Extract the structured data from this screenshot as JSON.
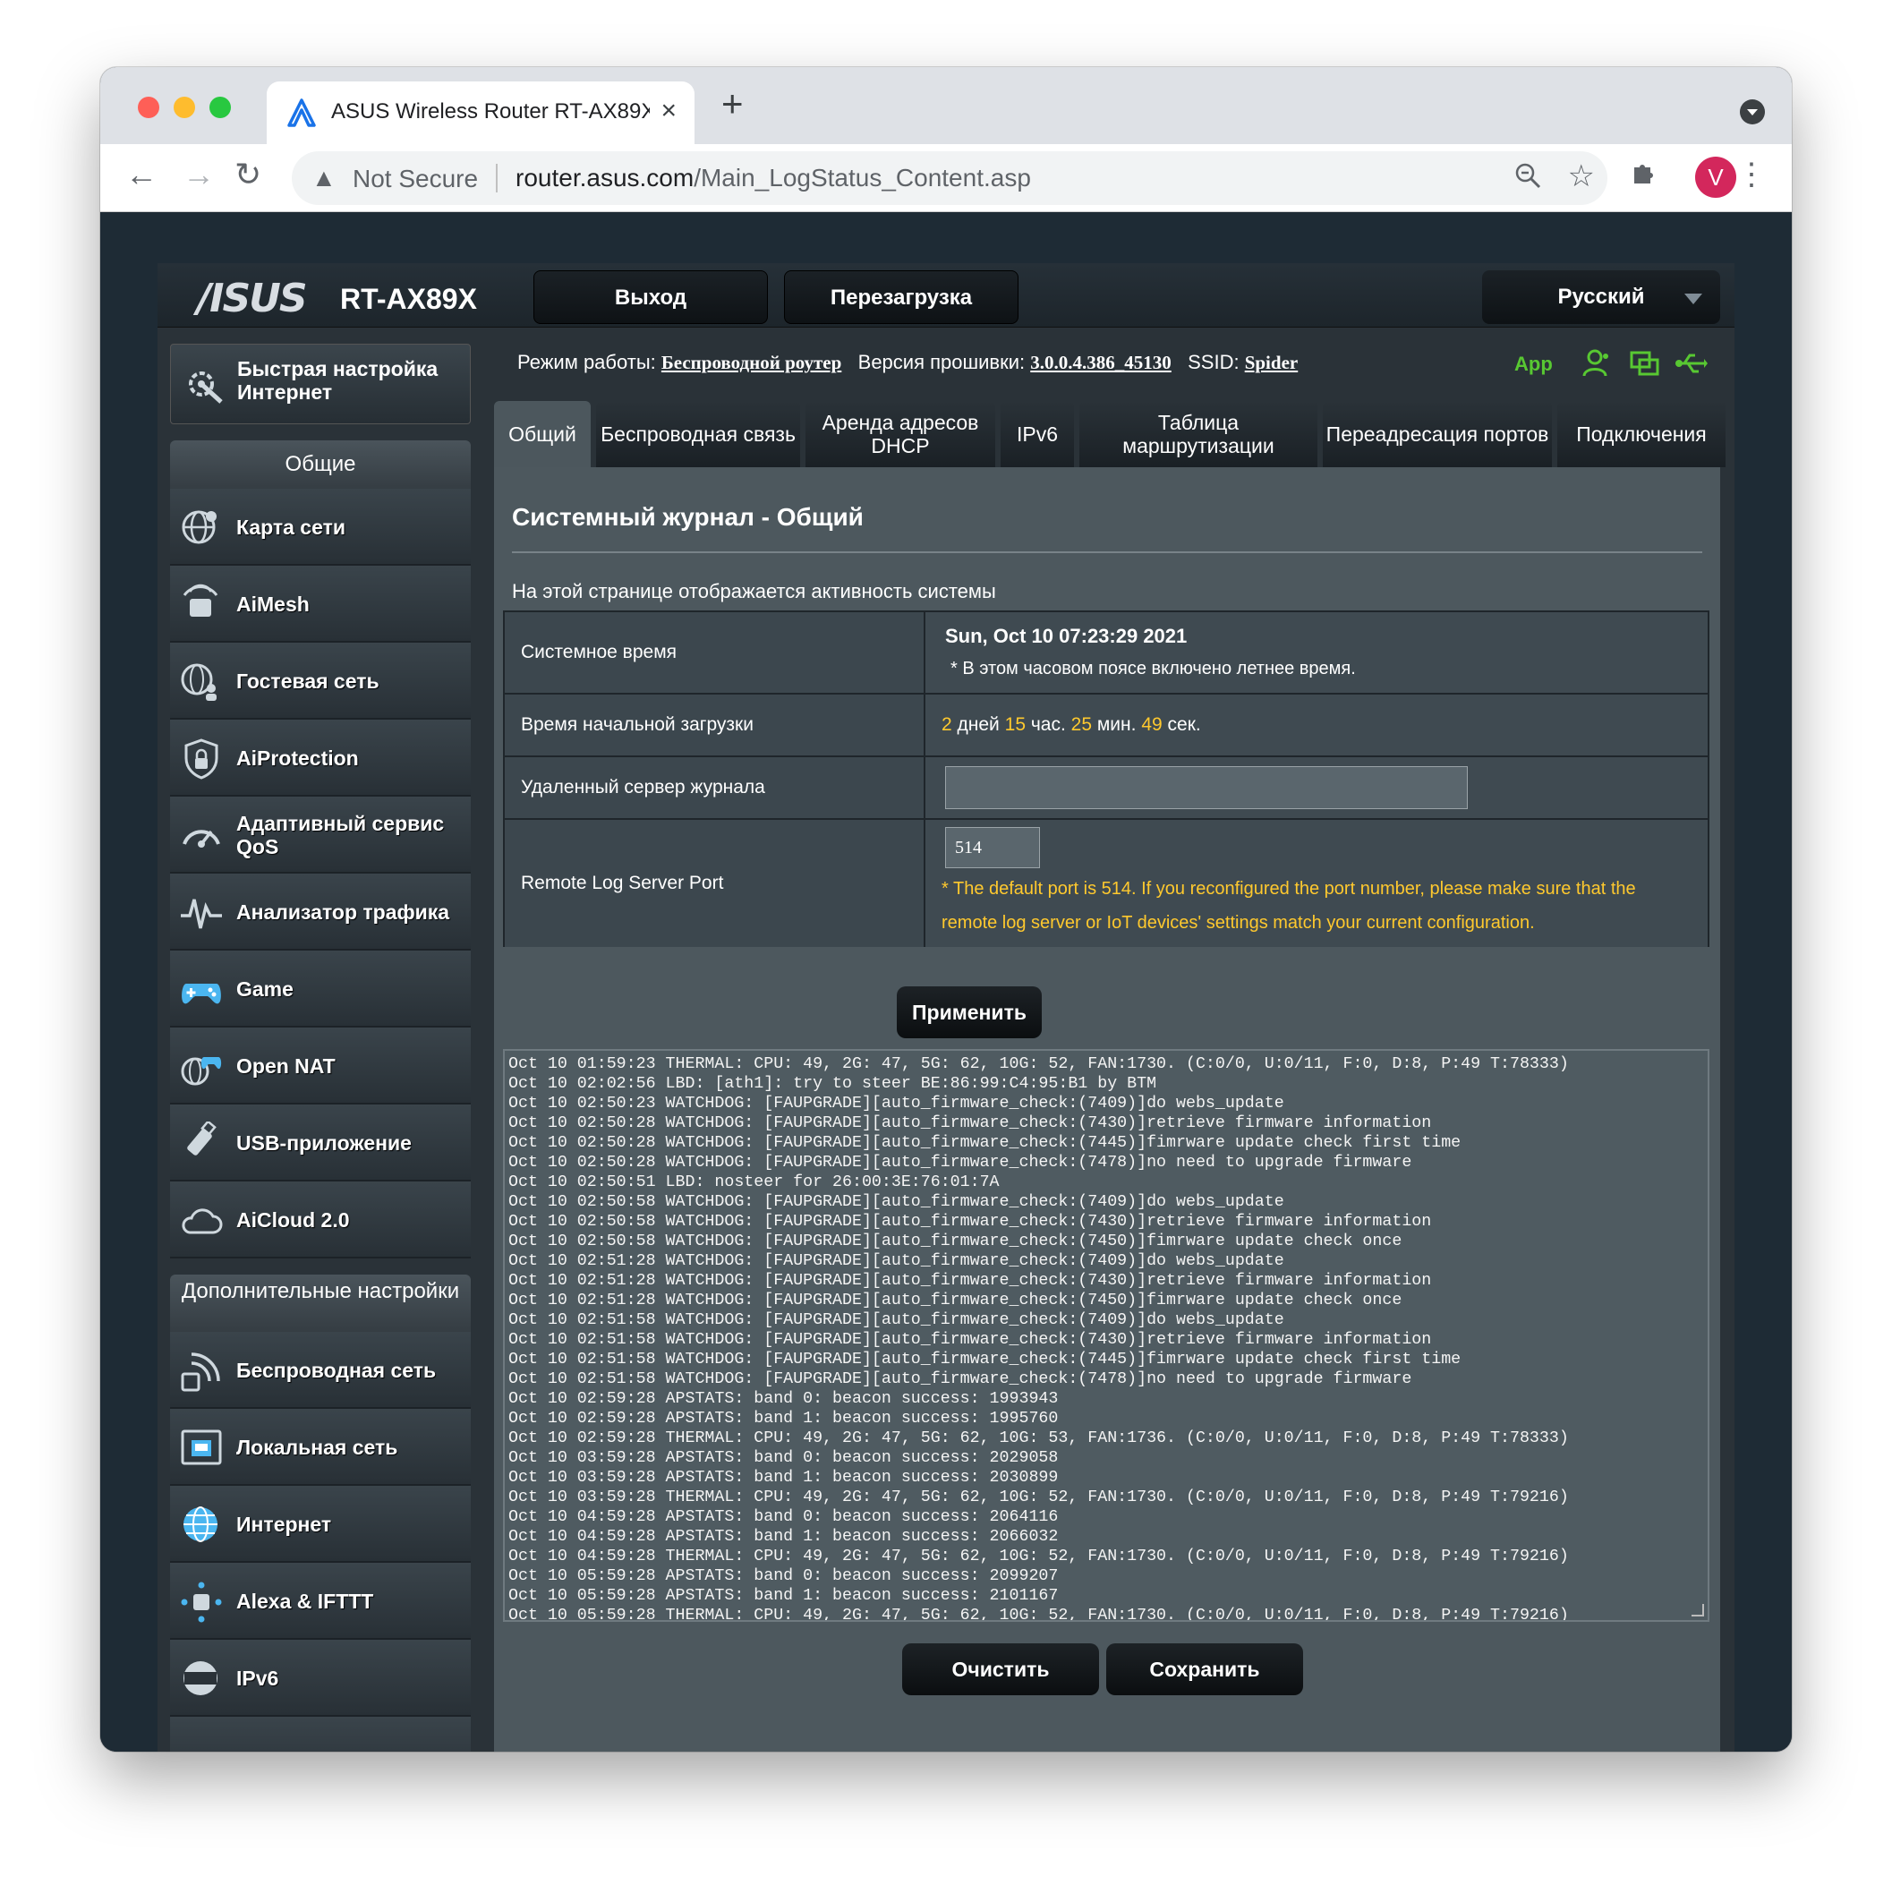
{
  "browser": {
    "tab_title": "ASUS Wireless Router RT-AX89X",
    "new_tab_glyph": "+",
    "security_label": "Not Secure",
    "url_host": "router.asus.com",
    "url_path": "/Main_LogStatus_Content.asp",
    "profile_initial": "V"
  },
  "router": {
    "brand": "/ISUS",
    "model": "RT-AX89X",
    "logout_label": "Выход",
    "reboot_label": "Перезагрузка",
    "language_label": "Русский",
    "status": {
      "mode_label": "Режим работы:",
      "mode_value": "Беспроводной роутер",
      "fw_label": "Версия прошивки:",
      "fw_value": "3.0.0.4.386_45130",
      "ssid_label": "SSID:",
      "ssid_value": "Spider",
      "app_label": "App"
    }
  },
  "sidebar": {
    "quick_setup": "Быстрая настройка Интернет",
    "general_header": "Общие",
    "general_items": [
      {
        "label": "Карта сети",
        "icon": "globe-map-icon"
      },
      {
        "label": "AiMesh",
        "icon": "aimesh-icon"
      },
      {
        "label": "Гостевая сеть",
        "icon": "guest-network-icon"
      },
      {
        "label": "AiProtection",
        "icon": "shield-lock-icon"
      },
      {
        "label": "Адаптивный сервис QoS",
        "icon": "gauge-icon"
      },
      {
        "label": "Анализатор трафика",
        "icon": "traffic-wave-icon"
      },
      {
        "label": "Game",
        "icon": "gamepad-icon"
      },
      {
        "label": "Open NAT",
        "icon": "open-nat-icon"
      },
      {
        "label": "USB-приложение",
        "icon": "usb-icon"
      },
      {
        "label": "AiCloud 2.0",
        "icon": "cloud-icon"
      }
    ],
    "advanced_header": "Дополнительные настройки",
    "advanced_items": [
      {
        "label": "Беспроводная сеть",
        "icon": "wireless-icon"
      },
      {
        "label": "Локальная сеть",
        "icon": "lan-icon"
      },
      {
        "label": "Интернет",
        "icon": "internet-globe-icon"
      },
      {
        "label": "Alexa & IFTTT",
        "icon": "alexa-icon"
      },
      {
        "label": "IPv6",
        "icon": "ipv6-icon"
      }
    ]
  },
  "tabs": [
    {
      "label": "Общий",
      "active": true
    },
    {
      "label": "Беспроводная связь"
    },
    {
      "label": "Аренда адресов DHCP"
    },
    {
      "label": "IPv6"
    },
    {
      "label": "Таблица маршрутизации"
    },
    {
      "label": "Переадресация портов"
    },
    {
      "label": "Подключения"
    }
  ],
  "main": {
    "title": "Системный журнал - Общий",
    "description": "На этой странице отображается активность системы",
    "system_time_label": "Системное время",
    "system_time_value": "Sun, Oct 10 07:23:29 2021",
    "dst_note": "* В этом часовом поясе включено летнее время.",
    "uptime_label": "Время начальной загрузки",
    "uptime": {
      "days": "2",
      "days_unit": "дней",
      "hours": "15",
      "hours_unit": "час.",
      "minutes": "25",
      "minutes_unit": "мин.",
      "seconds": "49",
      "seconds_unit": "сек."
    },
    "remote_server_label": "Удаленный сервер журнала",
    "remote_server_value": "",
    "remote_port_label": "Remote Log Server Port",
    "remote_port_value": "514",
    "remote_port_note": "* The default port is 514. If you reconfigured the port number, please make sure that the remote log server or IoT devices' settings match your current configuration.",
    "apply_label": "Применить",
    "clear_label": "Очистить",
    "save_label": "Сохранить",
    "log_lines": [
      "Oct 10 01:59:23 THERMAL: CPU: 49, 2G: 47, 5G: 62, 10G: 52, FAN:1730. (C:0/0, U:0/11, F:0, D:8, P:49 T:78333)",
      "Oct 10 02:02:56 LBD: [ath1]: try to steer BE:86:99:C4:95:B1 by BTM",
      "Oct 10 02:50:23 WATCHDOG: [FAUPGRADE][auto_firmware_check:(7409)]do webs_update",
      "Oct 10 02:50:28 WATCHDOG: [FAUPGRADE][auto_firmware_check:(7430)]retrieve firmware information",
      "Oct 10 02:50:28 WATCHDOG: [FAUPGRADE][auto_firmware_check:(7445)]fimrware update check first time",
      "Oct 10 02:50:28 WATCHDOG: [FAUPGRADE][auto_firmware_check:(7478)]no need to upgrade firmware",
      "Oct 10 02:50:51 LBD: nosteer for 26:00:3E:76:01:7A",
      "Oct 10 02:50:58 WATCHDOG: [FAUPGRADE][auto_firmware_check:(7409)]do webs_update",
      "Oct 10 02:50:58 WATCHDOG: [FAUPGRADE][auto_firmware_check:(7430)]retrieve firmware information",
      "Oct 10 02:50:58 WATCHDOG: [FAUPGRADE][auto_firmware_check:(7450)]fimrware update check once",
      "Oct 10 02:51:28 WATCHDOG: [FAUPGRADE][auto_firmware_check:(7409)]do webs_update",
      "Oct 10 02:51:28 WATCHDOG: [FAUPGRADE][auto_firmware_check:(7430)]retrieve firmware information",
      "Oct 10 02:51:28 WATCHDOG: [FAUPGRADE][auto_firmware_check:(7450)]fimrware update check once",
      "Oct 10 02:51:58 WATCHDOG: [FAUPGRADE][auto_firmware_check:(7409)]do webs_update",
      "Oct 10 02:51:58 WATCHDOG: [FAUPGRADE][auto_firmware_check:(7430)]retrieve firmware information",
      "Oct 10 02:51:58 WATCHDOG: [FAUPGRADE][auto_firmware_check:(7445)]fimrware update check first time",
      "Oct 10 02:51:58 WATCHDOG: [FAUPGRADE][auto_firmware_check:(7478)]no need to upgrade firmware",
      "Oct 10 02:59:28 APSTATS: band 0: beacon success: 1993943",
      "Oct 10 02:59:28 APSTATS: band 1: beacon success: 1995760",
      "Oct 10 02:59:28 THERMAL: CPU: 49, 2G: 47, 5G: 62, 10G: 53, FAN:1736. (C:0/0, U:0/11, F:0, D:8, P:49 T:78333)",
      "Oct 10 03:59:28 APSTATS: band 0: beacon success: 2029058",
      "Oct 10 03:59:28 APSTATS: band 1: beacon success: 2030899",
      "Oct 10 03:59:28 THERMAL: CPU: 49, 2G: 47, 5G: 62, 10G: 52, FAN:1730. (C:0/0, U:0/11, F:0, D:8, P:49 T:79216)",
      "Oct 10 04:59:28 APSTATS: band 0: beacon success: 2064116",
      "Oct 10 04:59:28 APSTATS: band 1: beacon success: 2066032",
      "Oct 10 04:59:28 THERMAL: CPU: 49, 2G: 47, 5G: 62, 10G: 52, FAN:1730. (C:0/0, U:0/11, F:0, D:8, P:49 T:79216)",
      "Oct 10 05:59:28 APSTATS: band 0: beacon success: 2099207",
      "Oct 10 05:59:28 APSTATS: band 1: beacon success: 2101167",
      "Oct 10 05:59:28 THERMAL: CPU: 49, 2G: 47, 5G: 62, 10G: 52, FAN:1730. (C:0/0, U:0/11, F:0, D:8, P:49 T:79216)"
    ]
  },
  "colors": {
    "accent_yellow": "#ffc92e",
    "status_green": "#58c832",
    "profile": "#d3275c"
  }
}
